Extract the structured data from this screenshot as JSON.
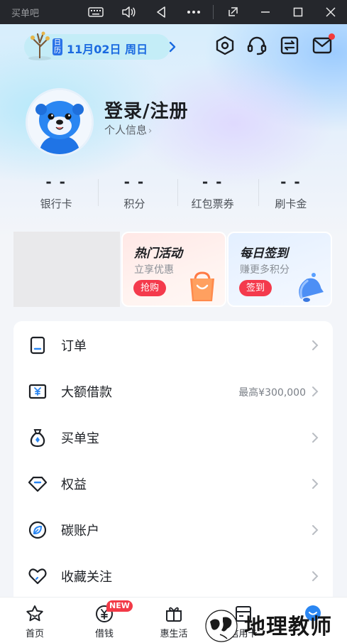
{
  "system_bar": {
    "app_name": "买单吧"
  },
  "header": {
    "calendar_tag": "日历",
    "date_text": "11月02日 周日"
  },
  "profile": {
    "title": "登录/注册",
    "personal_info": "个人信息"
  },
  "stats": [
    {
      "value": "- -",
      "label": "银行卡"
    },
    {
      "value": "- -",
      "label": "积分"
    },
    {
      "value": "- -",
      "label": "红包票券"
    },
    {
      "value": "- -",
      "label": "刷卡金"
    }
  ],
  "promos": {
    "hot": {
      "title": "热门活动",
      "subtitle": "立享优惠",
      "button": "抢购"
    },
    "sign": {
      "title": "每日签到",
      "subtitle": "赚更多积分",
      "button": "签到"
    }
  },
  "menu": [
    {
      "label": "订单",
      "extra": "",
      "icon": "order-icon"
    },
    {
      "label": "大额借款",
      "extra": "最高¥300,000",
      "icon": "loan-icon"
    },
    {
      "label": "买单宝",
      "extra": "",
      "icon": "money-bag-icon"
    },
    {
      "label": "权益",
      "extra": "",
      "icon": "diamond-icon"
    },
    {
      "label": "碳账户",
      "extra": "",
      "icon": "carbon-leaf-icon"
    },
    {
      "label": "收藏关注",
      "extra": "",
      "icon": "heart-icon"
    }
  ],
  "tabs": [
    {
      "label": "首页",
      "icon": "star-home-icon"
    },
    {
      "label": "借钱",
      "icon": "yuan-plus-icon"
    },
    {
      "label": "惠生活",
      "icon": "gift-icon"
    },
    {
      "label": "信用卡",
      "icon": "card-icon"
    },
    {
      "label": "",
      "icon": "mascot-me-icon"
    }
  ],
  "badges": {
    "new": "NEW"
  },
  "watermark": {
    "text": "地理教师"
  },
  "colors": {
    "accent_blue": "#1a6ae0",
    "promo_red": "#f43a4c",
    "notification_red": "#f33a3a"
  }
}
